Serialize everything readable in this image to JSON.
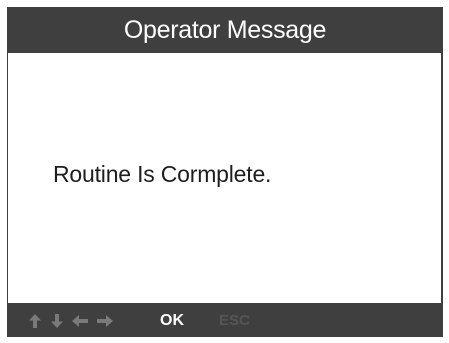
{
  "dialog": {
    "title": "Operator Message",
    "message": "Routine Is Cormplete."
  },
  "key_bar": {
    "arrows": [
      "arrow-up-icon",
      "arrow-down-icon",
      "arrow-left-icon",
      "arrow-right-icon"
    ],
    "ok_label": "OK",
    "esc_label": "ESC",
    "active_color": "#ffffff",
    "disabled_color": "#555555"
  },
  "colors": {
    "frame": "#3f3f3f",
    "content_bg": "#ffffff",
    "message_text": "#1e1e1e",
    "arrow_icons": "#7a7a7a"
  }
}
